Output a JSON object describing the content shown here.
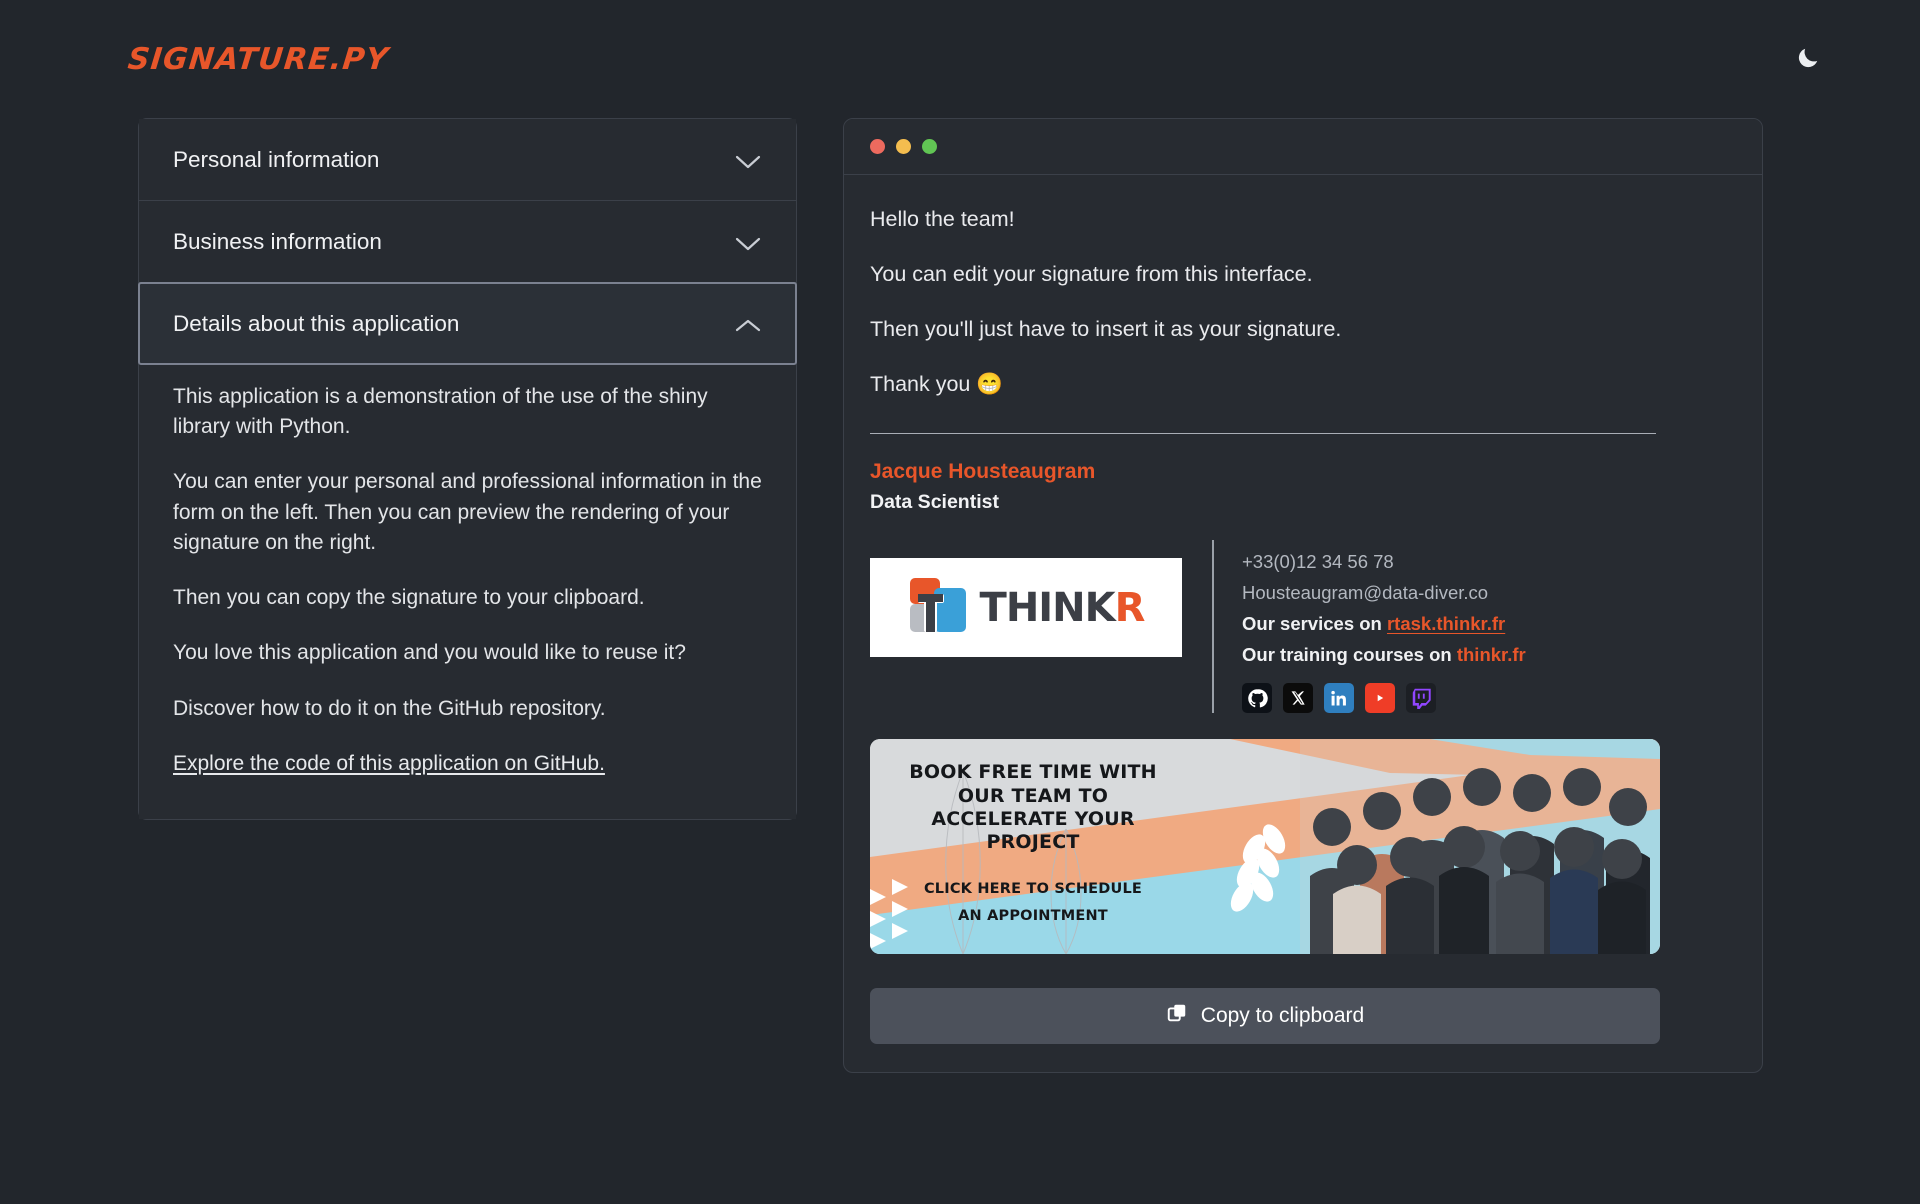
{
  "header": {
    "brand": "signature.py",
    "theme_toggle_icon": "moon-icon"
  },
  "sidebar": {
    "items": [
      {
        "label": "Personal information",
        "expanded": false,
        "icon": "chevron-down-icon"
      },
      {
        "label": "Business information",
        "expanded": false,
        "icon": "chevron-down-icon"
      },
      {
        "label": "Details about this application",
        "expanded": true,
        "icon": "chevron-up-icon"
      }
    ],
    "details_paragraphs": [
      "This application is a demonstration of the use of the shiny library with Python.",
      "You can enter your personal and professional information in the form on the left. Then you can preview the rendering of your signature on the right.",
      "Then you can copy the signature to your clipboard.",
      "You love this application and you would like to reuse it?",
      "Discover how to do it on the GitHub repository."
    ],
    "details_link": "Explore the code of this application on GitHub."
  },
  "preview": {
    "window_dots": [
      "red",
      "yellow",
      "green"
    ],
    "message_lines": [
      "Hello the team!",
      "You can edit your signature from this interface.",
      "Then you'll just have to insert it as your signature.",
      "Thank you 😁"
    ],
    "signature": {
      "name": "Jacque Housteaugram",
      "role": "Data Scientist",
      "logo_dark": "THINK",
      "logo_accent": "R",
      "phone": "+33(0)12 34 56 78",
      "email": "Housteaugram@data-diver.co",
      "services_label": "Our services on",
      "services_link": "rtask.thinkr.fr",
      "training_label": "Our training courses on",
      "training_link": "thinkr.fr",
      "socials": [
        {
          "name": "github-icon",
          "color": "#0d1117"
        },
        {
          "name": "x-twitter-icon",
          "color": "#0b0b0b"
        },
        {
          "name": "linkedin-icon",
          "color": "#2f7fbf"
        },
        {
          "name": "youtube-icon",
          "color": "#ef3d27"
        },
        {
          "name": "twitch-icon",
          "color": "#9146ff"
        }
      ]
    },
    "banner": {
      "headline": "BOOK FREE TIME WITH OUR TEAM TO ACCELERATE YOUR PROJECT",
      "subline_1": "CLICK HERE TO SCHEDULE",
      "subline_2": "AN APPOINTMENT"
    },
    "copy_button": {
      "label": "Copy to clipboard",
      "icon": "copy-icon"
    }
  },
  "colors": {
    "accent": "#e8562a",
    "page_bg": "#22262c",
    "card_bg": "#272b31",
    "border": "#3b4049",
    "button_bg": "#4c515b"
  }
}
